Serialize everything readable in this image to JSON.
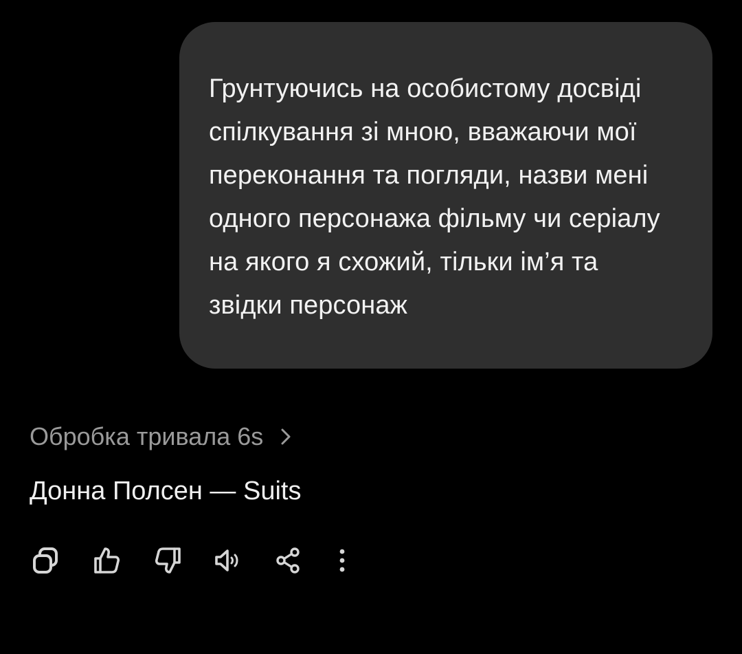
{
  "conversation": {
    "user_message": "Грунтуючись на особистому досвіді спілкування зі мною, вважаючи мої переконання та погляди, назви мені одного персонажа фільму чи серіалу на якого я схожий, тільки ім’я та звідки персонаж",
    "thinking_label": "Обробка тривала 6s",
    "assistant_reply": "Донна Полсен — Suits"
  },
  "actions": {
    "icons": [
      "copy-icon",
      "thumbs-up-icon",
      "thumbs-down-icon",
      "read-aloud-icon",
      "share-icon",
      "more-icon"
    ]
  },
  "colors": {
    "background": "#000000",
    "bubble": "#2f2f2f",
    "muted_text": "#9a9a9a",
    "icon": "#d6d6d6"
  }
}
